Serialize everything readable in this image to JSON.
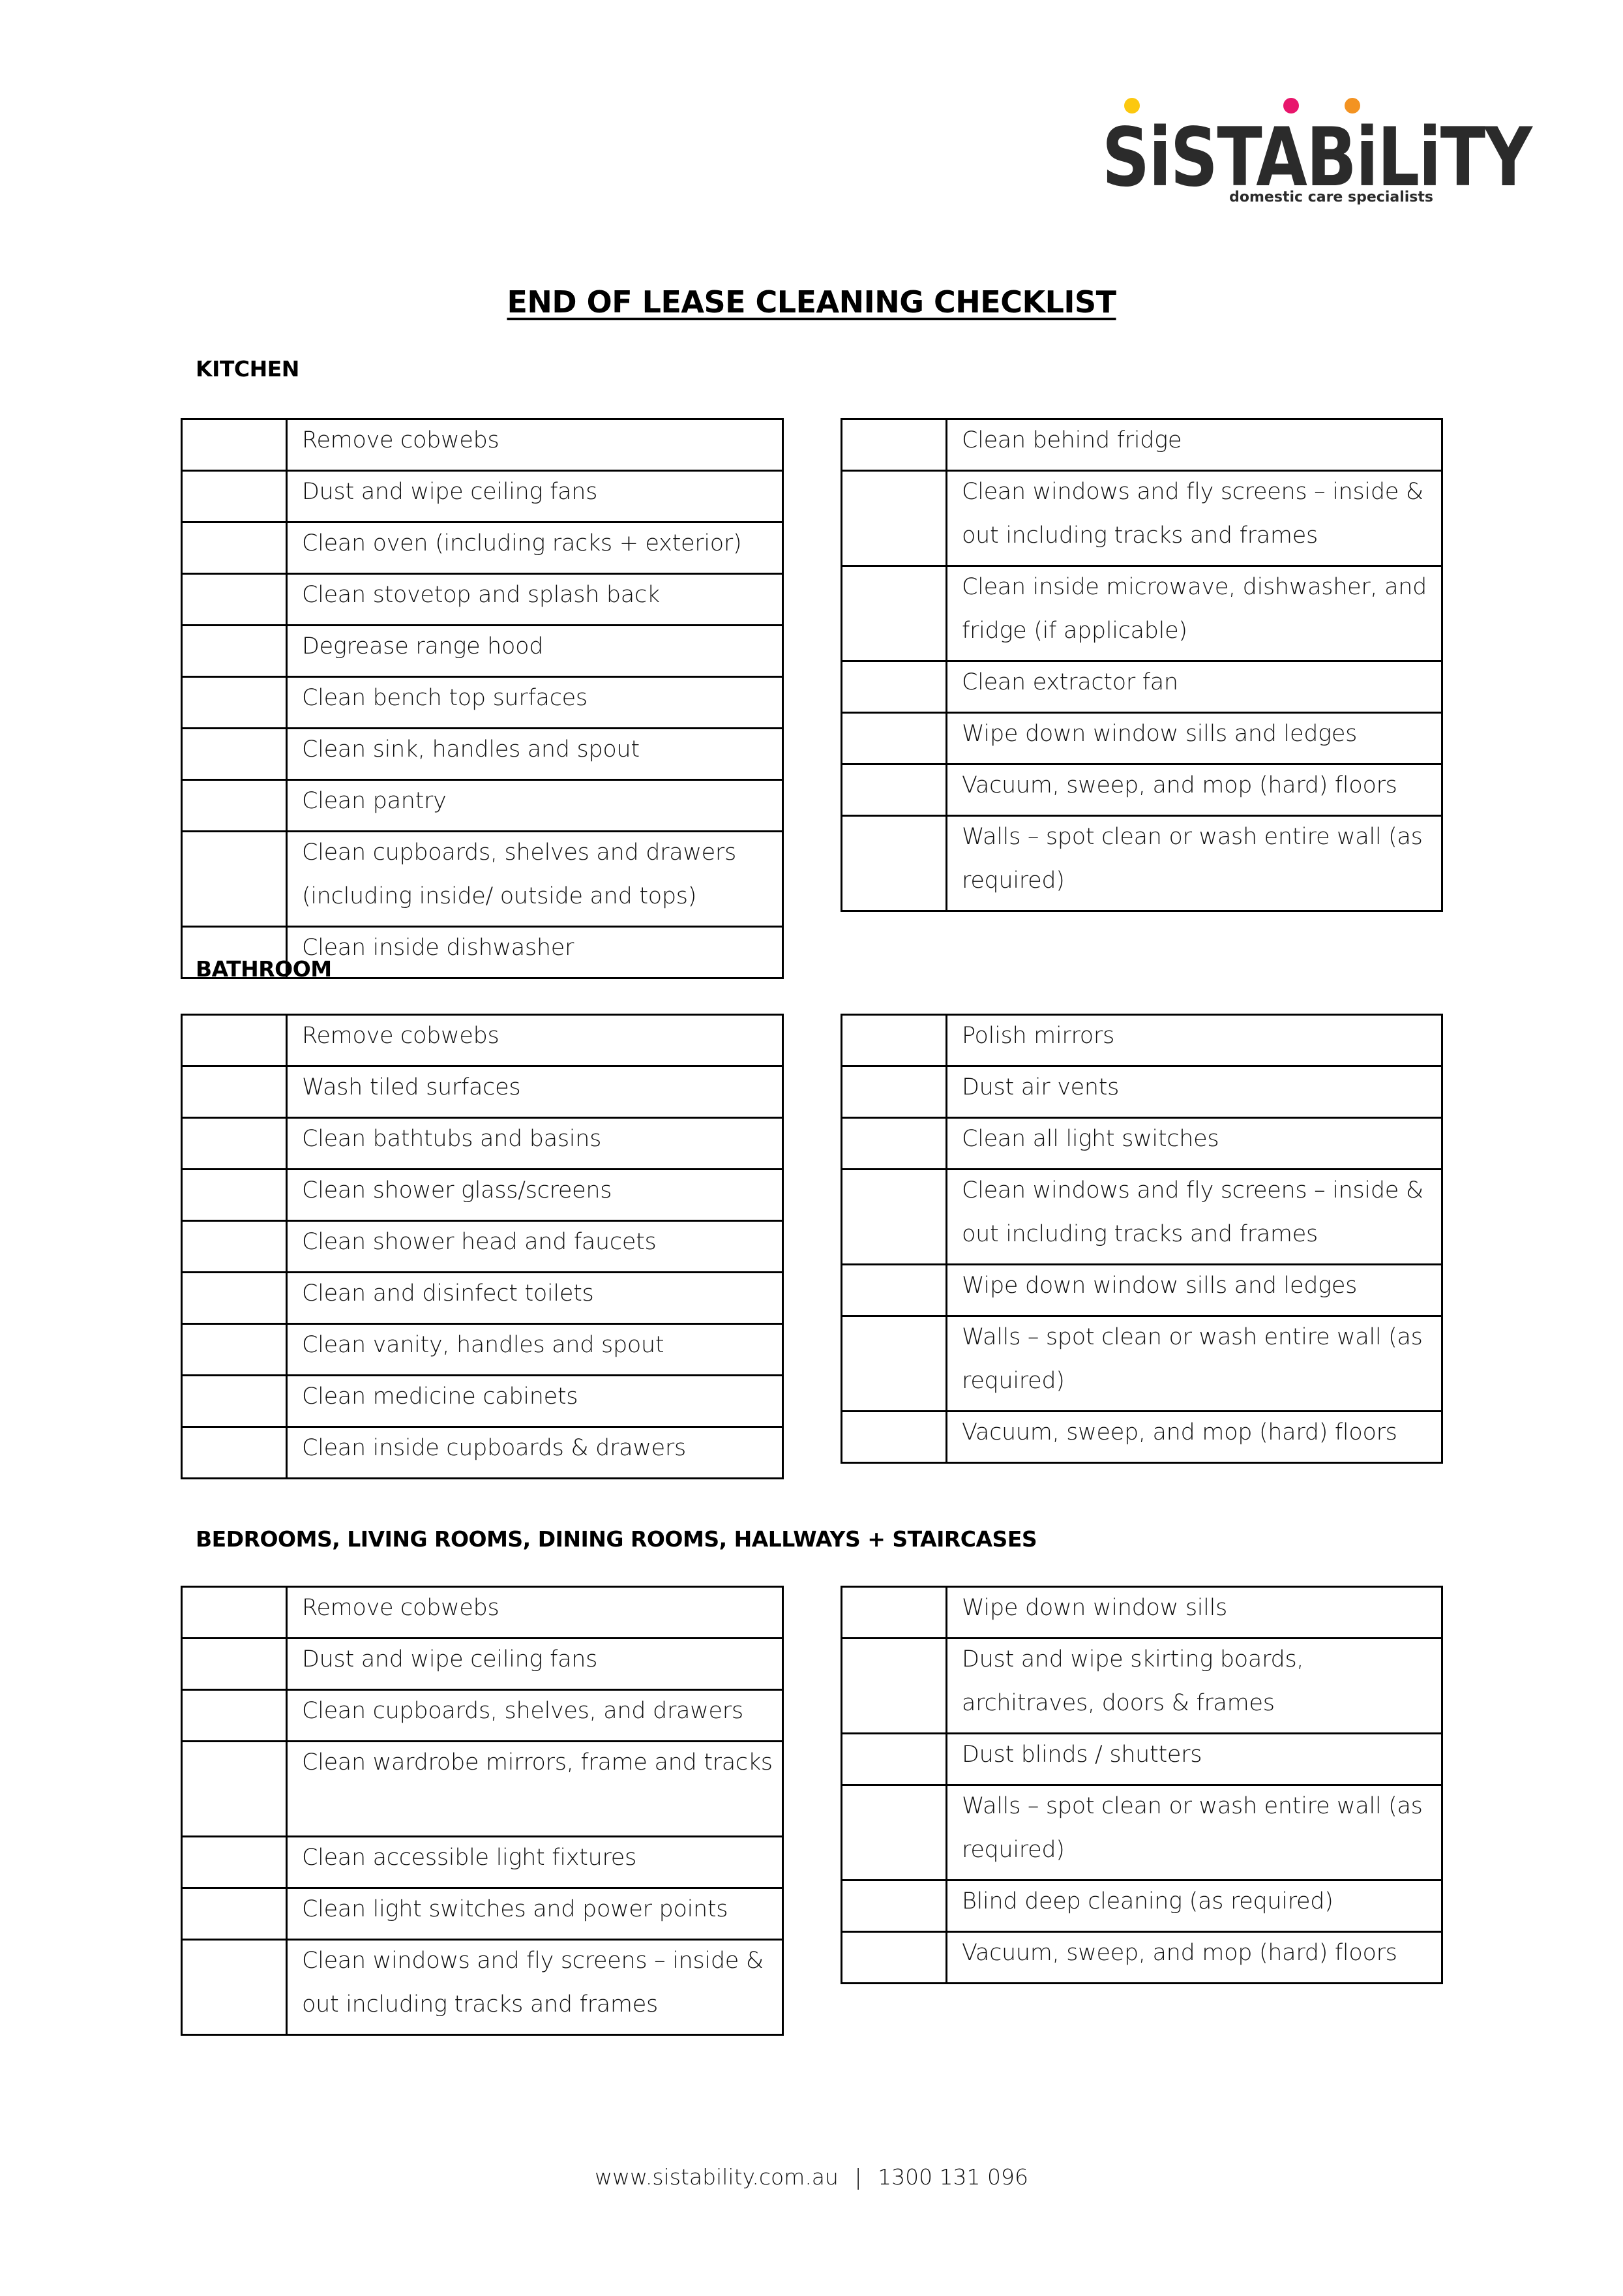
{
  "brand": {
    "name": "SiSTABiLiTY",
    "tagline": "domestic care specialists",
    "dot_colors": [
      "#fcc80f",
      "#e8166c",
      "#f39322"
    ],
    "text_color": "#2b2b2b",
    "logo_icon": "brand-logo"
  },
  "document": {
    "title": "END OF LEASE CLEANING CHECKLIST"
  },
  "sections": [
    {
      "heading": "KITCHEN",
      "left": [
        "Remove cobwebs",
        "Dust and wipe ceiling fans",
        "Clean oven (including racks + exterior)",
        "Clean stovetop and splash back",
        "Degrease range hood",
        "Clean bench top surfaces",
        "Clean sink, handles and spout",
        "Clean pantry",
        "Clean cupboards, shelves and drawers (including inside/ outside and tops)",
        "Clean inside dishwasher"
      ],
      "right": [
        "Clean behind fridge",
        "Clean windows and fly screens – inside & out including tracks and frames",
        "Clean inside microwave, dishwasher, and fridge (if applicable)",
        "Clean extractor fan",
        "Wipe down window sills and ledges",
        "Vacuum, sweep, and mop (hard) floors",
        "Walls – spot clean or wash entire wall (as required)"
      ]
    },
    {
      "heading": "BATHROOM",
      "left": [
        "Remove cobwebs",
        "Wash tiled surfaces",
        "Clean bathtubs and basins",
        "Clean shower glass/screens",
        "Clean shower head and faucets",
        "Clean and disinfect toilets",
        "Clean vanity, handles and spout",
        "Clean medicine cabinets",
        "Clean inside cupboards & drawers"
      ],
      "right": [
        "Polish mirrors",
        "Dust air vents",
        "Clean all light switches",
        "Clean windows and fly screens – inside & out including tracks and frames",
        "Wipe down window sills and ledges",
        "Walls – spot clean or wash entire wall (as required)",
        "Vacuum, sweep, and mop (hard) floors"
      ]
    },
    {
      "heading": "BEDROOMS, LIVING ROOMS, DINING ROOMS, HALLWAYS + STAIRCASES",
      "left": [
        "Remove cobwebs",
        "Dust and wipe ceiling fans",
        "Clean cupboards, shelves, and drawers",
        "Clean wardrobe mirrors, frame and tracks",
        "Clean accessible light fixtures",
        "Clean light switches and power points",
        "Clean windows and fly screens – inside & out including tracks and frames"
      ],
      "right": [
        "Wipe down window sills",
        "Dust and wipe skirting boards, architraves, doors & frames",
        "Dust blinds / shutters",
        "Walls – spot clean or wash entire wall (as required)",
        "Blind deep cleaning (as required)",
        "Vacuum, sweep, and mop (hard) floors"
      ]
    }
  ],
  "footer": {
    "website": "www.sistability.com.au",
    "separator": "|",
    "phone": "1300 131 096"
  }
}
